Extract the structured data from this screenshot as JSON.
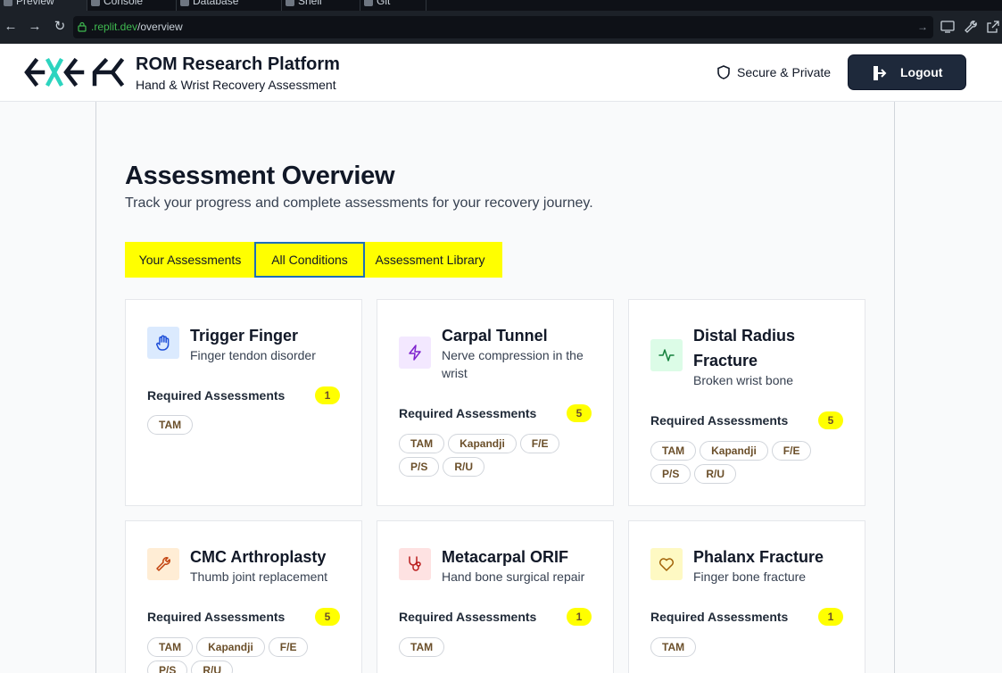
{
  "browser": {
    "tabs": [
      "Preview",
      "Console",
      "Database",
      "Shell",
      "Git"
    ],
    "url_domain": ".replit.dev",
    "url_path": "/overview"
  },
  "header": {
    "app_title": "ROM Research Platform",
    "app_subtitle": "Hand & Wrist Recovery Assessment",
    "secure_label": "Secure & Private",
    "logout_label": "Logout",
    "logo_text": "EXER"
  },
  "page": {
    "title": "Assessment Overview",
    "subtitle": "Track your progress and complete assessments for your recovery journey."
  },
  "tabs": [
    {
      "label": "Your Assessments",
      "selected": false
    },
    {
      "label": "All Conditions",
      "selected": true
    },
    {
      "label": "Assessment Library",
      "selected": false
    }
  ],
  "cards": [
    {
      "title": "Trigger Finger",
      "description": "Finger tendon disorder",
      "required_label": "Required Assessments",
      "count": "1",
      "chips": [
        "TAM"
      ],
      "icon": "hand-icon",
      "icon_bg": "#dbeafe",
      "icon_color": "#1d4ed8"
    },
    {
      "title": "Carpal Tunnel",
      "description": "Nerve compression in the wrist",
      "required_label": "Required Assessments",
      "count": "5",
      "chips": [
        "TAM",
        "Kapandji",
        "F/E",
        "P/S",
        "R/U"
      ],
      "icon": "lightning-icon",
      "icon_bg": "#f3e8ff",
      "icon_color": "#7e22ce"
    },
    {
      "title": "Distal Radius Fracture",
      "description": "Broken wrist bone",
      "required_label": "Required Assessments",
      "count": "5",
      "chips": [
        "TAM",
        "Kapandji",
        "F/E",
        "P/S",
        "R/U"
      ],
      "icon": "pulse-icon",
      "icon_bg": "#dcfce7",
      "icon_color": "#15803d"
    },
    {
      "title": "CMC Arthroplasty",
      "description": "Thumb joint replacement",
      "required_label": "Required Assessments",
      "count": "5",
      "chips": [
        "TAM",
        "Kapandji",
        "F/E",
        "P/S",
        "R/U"
      ],
      "icon": "wrench-icon",
      "icon_bg": "#ffedd5",
      "icon_color": "#c2410c"
    },
    {
      "title": "Metacarpal ORIF",
      "description": "Hand bone surgical repair",
      "required_label": "Required Assessments",
      "count": "1",
      "chips": [
        "TAM"
      ],
      "icon": "stethoscope-icon",
      "icon_bg": "#fee2e2",
      "icon_color": "#b91c1c"
    },
    {
      "title": "Phalanx Fracture",
      "description": "Finger bone fracture",
      "required_label": "Required Assessments",
      "count": "1",
      "chips": [
        "TAM"
      ],
      "icon": "heart-icon",
      "icon_bg": "#fef9c3",
      "icon_color": "#a16207"
    }
  ],
  "colors": {
    "highlight": "#ffff00",
    "dark_button": "#1e293b",
    "selected_tab_border": "#1d6fb8"
  }
}
